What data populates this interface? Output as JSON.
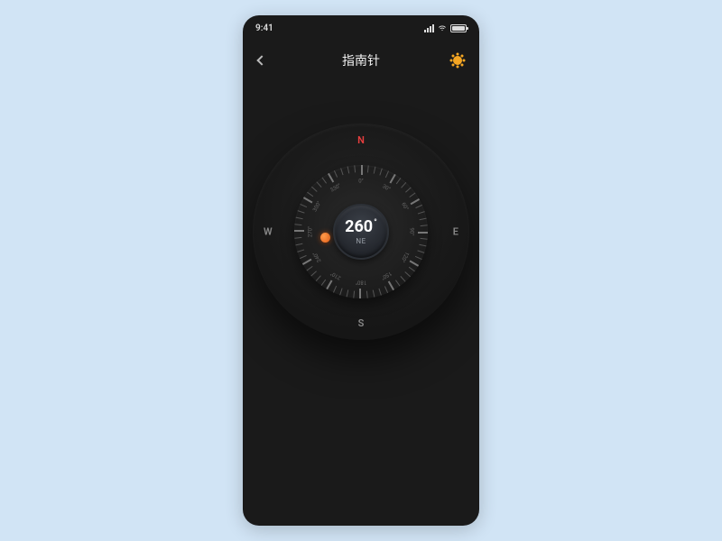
{
  "status": {
    "time": "9:41"
  },
  "nav": {
    "title": "指南针"
  },
  "compass": {
    "heading_value": "260",
    "heading_symbol": "°",
    "direction": "NE",
    "cardinals": {
      "n": "N",
      "e": "E",
      "s": "S",
      "w": "W"
    },
    "degree_labels": [
      "0°",
      "30°",
      "60°",
      "90°",
      "120°",
      "150°",
      "180°",
      "210°",
      "240°",
      "270°",
      "300°",
      "330°"
    ],
    "indicator_bearing": 260
  },
  "colors": {
    "accent_orange": "#e8621a",
    "north_red": "#e63e3e",
    "bg_phone": "#1a1a1a",
    "bg_page": "#d1e4f5"
  }
}
